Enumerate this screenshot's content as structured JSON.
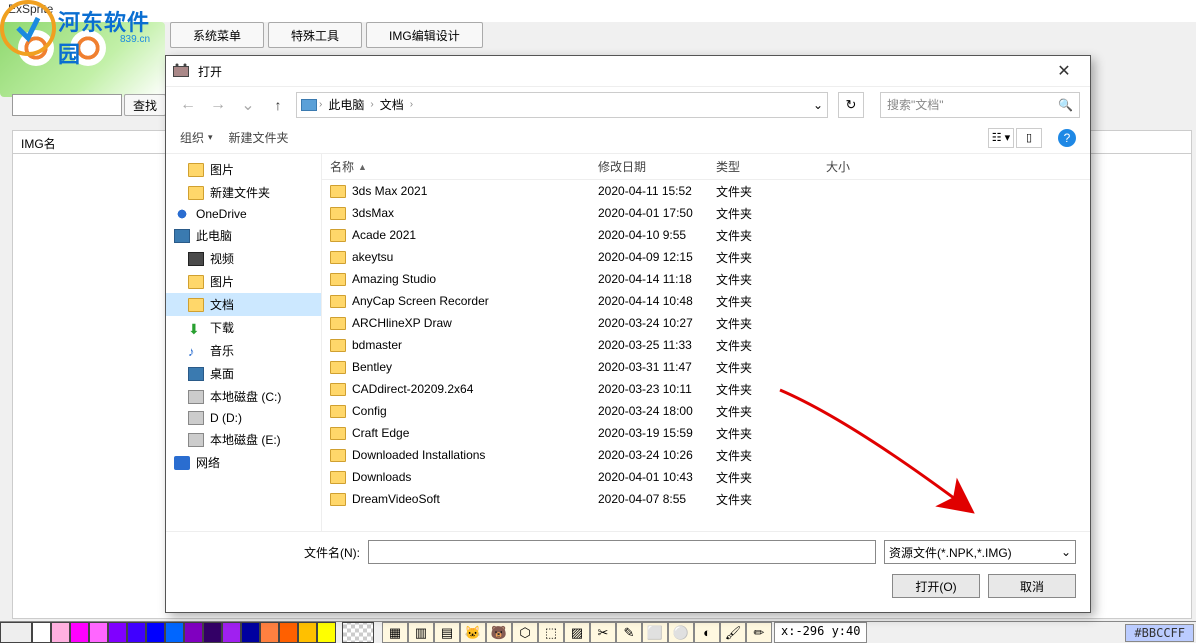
{
  "app": {
    "title": "ExSprite",
    "logo_text": "河东软件园",
    "logo_url": "839.cn",
    "tabs": [
      "系统菜单",
      "特殊工具",
      "IMG编辑设计"
    ],
    "search_btn": "查找",
    "list_header": "IMG名"
  },
  "dialog": {
    "title": "打开",
    "close": "✕",
    "nav": {
      "breadcrumb_root": "此电脑",
      "breadcrumb_folder": "文档",
      "search_placeholder": "搜索\"文档\"",
      "dropdown": "⌄",
      "refresh": "↻"
    },
    "toolbar": {
      "org": "组织",
      "newfolder": "新建文件夹"
    },
    "sidebar": [
      {
        "label": "图片",
        "icon": "folder",
        "indent": 2
      },
      {
        "label": "新建文件夹",
        "icon": "folder",
        "indent": 2
      },
      {
        "label": "OneDrive",
        "icon": "cloud",
        "indent": 1
      },
      {
        "label": "此电脑",
        "icon": "pc",
        "indent": 1
      },
      {
        "label": "视频",
        "icon": "vid",
        "indent": 2
      },
      {
        "label": "图片",
        "icon": "folder",
        "indent": 2
      },
      {
        "label": "文档",
        "icon": "folder",
        "indent": 2,
        "selected": true
      },
      {
        "label": "下载",
        "icon": "dl",
        "indent": 2
      },
      {
        "label": "音乐",
        "icon": "music",
        "indent": 2
      },
      {
        "label": "桌面",
        "icon": "pc",
        "indent": 2
      },
      {
        "label": "本地磁盘 (C:)",
        "icon": "disk",
        "indent": 2
      },
      {
        "label": "D (D:)",
        "icon": "disk",
        "indent": 2
      },
      {
        "label": "本地磁盘 (E:)",
        "icon": "disk",
        "indent": 2
      },
      {
        "label": "网络",
        "icon": "net",
        "indent": 1
      }
    ],
    "columns": {
      "name": "名称",
      "date": "修改日期",
      "type": "类型",
      "size": "大小"
    },
    "files": [
      {
        "name": "3ds Max 2021",
        "date": "2020-04-11 15:52",
        "type": "文件夹"
      },
      {
        "name": "3dsMax",
        "date": "2020-04-01 17:50",
        "type": "文件夹"
      },
      {
        "name": "Acade 2021",
        "date": "2020-04-10 9:55",
        "type": "文件夹"
      },
      {
        "name": "akeytsu",
        "date": "2020-04-09 12:15",
        "type": "文件夹"
      },
      {
        "name": "Amazing Studio",
        "date": "2020-04-14 11:18",
        "type": "文件夹"
      },
      {
        "name": "AnyCap Screen Recorder",
        "date": "2020-04-14 10:48",
        "type": "文件夹"
      },
      {
        "name": "ARCHlineXP Draw",
        "date": "2020-03-24 10:27",
        "type": "文件夹"
      },
      {
        "name": "bdmaster",
        "date": "2020-03-25 11:33",
        "type": "文件夹"
      },
      {
        "name": "Bentley",
        "date": "2020-03-31 11:47",
        "type": "文件夹"
      },
      {
        "name": "CADdirect-20209.2x64",
        "date": "2020-03-23 10:11",
        "type": "文件夹"
      },
      {
        "name": "Config",
        "date": "2020-03-24 18:00",
        "type": "文件夹"
      },
      {
        "name": "Craft Edge",
        "date": "2020-03-19 15:59",
        "type": "文件夹"
      },
      {
        "name": "Downloaded Installations",
        "date": "2020-03-24 10:26",
        "type": "文件夹"
      },
      {
        "name": "Downloads",
        "date": "2020-04-01 10:43",
        "type": "文件夹"
      },
      {
        "name": "DreamVideoSoft",
        "date": "2020-04-07 8:55",
        "type": "文件夹"
      }
    ],
    "footer": {
      "filename_label": "文件名(N):",
      "filter": "资源文件(*.NPK,*.IMG)",
      "open": "打开(O)",
      "cancel": "取消"
    }
  },
  "palette": {
    "colors": [
      "#ffffff",
      "#ffb0e0",
      "#ff00ff",
      "#ff66ff",
      "#8000ff",
      "#4000ff",
      "#0000ff",
      "#0066ff",
      "#8000c0",
      "#330066",
      "#a020f0",
      "#0000a0",
      "#ff8040",
      "#ff6000",
      "#ffc000",
      "#ffff00"
    ],
    "tool_glyphs": [
      "▦",
      "▥",
      "▤",
      "🐱",
      "🐻",
      "⬡",
      "⬚",
      "▨",
      "✂",
      "✎",
      "⬜",
      "⚪",
      "◐",
      "🖌",
      "✏"
    ],
    "coord": "x:-296 y:40",
    "color_hex": "#BBCCFF"
  }
}
